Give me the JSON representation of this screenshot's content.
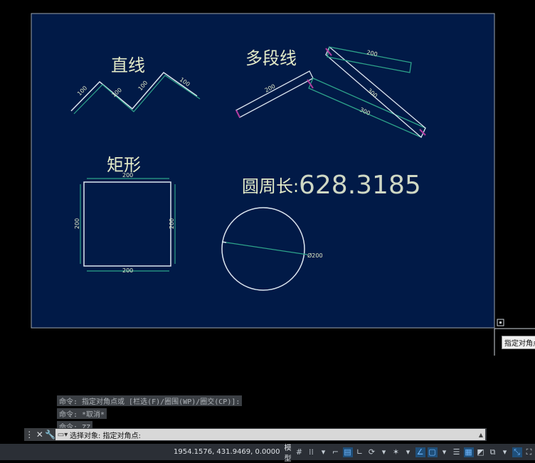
{
  "drawing": {
    "title_line": "直线",
    "title_polyline": "多段线",
    "title_rect": "矩形",
    "circumference_label": "圆周长:",
    "circumference_value": "628.3185",
    "line_dims": [
      "100",
      "100",
      "100",
      "100"
    ],
    "polyline_dims": [
      "200",
      "200",
      "300",
      "300"
    ],
    "rect_dims": {
      "top": "200",
      "bottom": "200",
      "left": "200",
      "right": "200"
    },
    "circle_dim": "Ø200",
    "tooltip": "指定对角点"
  },
  "command_history": [
    "命令: 指定对角点或 [栏选(F)/圈围(WP)/圈交(CP)]:",
    "命令: *取消*",
    "命令: ZZ"
  ],
  "command_line": {
    "prompt": "选择对象: 指定对角点:"
  },
  "status_bar": {
    "coordinates": "1954.1576, 431.9469, 0.0000",
    "model_label": "模型"
  },
  "colors": {
    "paper": "#011a47",
    "geometry_white": "#dde6f0",
    "dimension_green": "#2ea38a",
    "text_yellow": "#e4ebc8",
    "endpoint_magenta": "#b43ba0"
  }
}
